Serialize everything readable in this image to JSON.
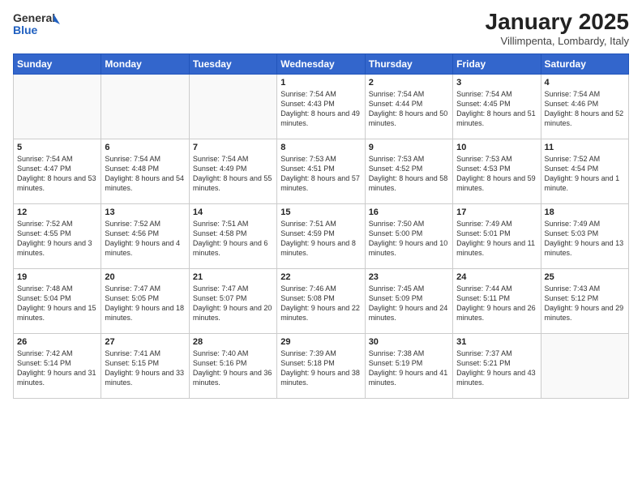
{
  "header": {
    "logo_general": "General",
    "logo_blue": "Blue",
    "month_title": "January 2025",
    "subtitle": "Villimpenta, Lombardy, Italy"
  },
  "weekdays": [
    "Sunday",
    "Monday",
    "Tuesday",
    "Wednesday",
    "Thursday",
    "Friday",
    "Saturday"
  ],
  "weeks": [
    [
      {
        "day": "",
        "info": ""
      },
      {
        "day": "",
        "info": ""
      },
      {
        "day": "",
        "info": ""
      },
      {
        "day": "1",
        "info": "Sunrise: 7:54 AM\nSunset: 4:43 PM\nDaylight: 8 hours\nand 49 minutes."
      },
      {
        "day": "2",
        "info": "Sunrise: 7:54 AM\nSunset: 4:44 PM\nDaylight: 8 hours\nand 50 minutes."
      },
      {
        "day": "3",
        "info": "Sunrise: 7:54 AM\nSunset: 4:45 PM\nDaylight: 8 hours\nand 51 minutes."
      },
      {
        "day": "4",
        "info": "Sunrise: 7:54 AM\nSunset: 4:46 PM\nDaylight: 8 hours\nand 52 minutes."
      }
    ],
    [
      {
        "day": "5",
        "info": "Sunrise: 7:54 AM\nSunset: 4:47 PM\nDaylight: 8 hours\nand 53 minutes."
      },
      {
        "day": "6",
        "info": "Sunrise: 7:54 AM\nSunset: 4:48 PM\nDaylight: 8 hours\nand 54 minutes."
      },
      {
        "day": "7",
        "info": "Sunrise: 7:54 AM\nSunset: 4:49 PM\nDaylight: 8 hours\nand 55 minutes."
      },
      {
        "day": "8",
        "info": "Sunrise: 7:53 AM\nSunset: 4:51 PM\nDaylight: 8 hours\nand 57 minutes."
      },
      {
        "day": "9",
        "info": "Sunrise: 7:53 AM\nSunset: 4:52 PM\nDaylight: 8 hours\nand 58 minutes."
      },
      {
        "day": "10",
        "info": "Sunrise: 7:53 AM\nSunset: 4:53 PM\nDaylight: 8 hours\nand 59 minutes."
      },
      {
        "day": "11",
        "info": "Sunrise: 7:52 AM\nSunset: 4:54 PM\nDaylight: 9 hours\nand 1 minute."
      }
    ],
    [
      {
        "day": "12",
        "info": "Sunrise: 7:52 AM\nSunset: 4:55 PM\nDaylight: 9 hours\nand 3 minutes."
      },
      {
        "day": "13",
        "info": "Sunrise: 7:52 AM\nSunset: 4:56 PM\nDaylight: 9 hours\nand 4 minutes."
      },
      {
        "day": "14",
        "info": "Sunrise: 7:51 AM\nSunset: 4:58 PM\nDaylight: 9 hours\nand 6 minutes."
      },
      {
        "day": "15",
        "info": "Sunrise: 7:51 AM\nSunset: 4:59 PM\nDaylight: 9 hours\nand 8 minutes."
      },
      {
        "day": "16",
        "info": "Sunrise: 7:50 AM\nSunset: 5:00 PM\nDaylight: 9 hours\nand 10 minutes."
      },
      {
        "day": "17",
        "info": "Sunrise: 7:49 AM\nSunset: 5:01 PM\nDaylight: 9 hours\nand 11 minutes."
      },
      {
        "day": "18",
        "info": "Sunrise: 7:49 AM\nSunset: 5:03 PM\nDaylight: 9 hours\nand 13 minutes."
      }
    ],
    [
      {
        "day": "19",
        "info": "Sunrise: 7:48 AM\nSunset: 5:04 PM\nDaylight: 9 hours\nand 15 minutes."
      },
      {
        "day": "20",
        "info": "Sunrise: 7:47 AM\nSunset: 5:05 PM\nDaylight: 9 hours\nand 18 minutes."
      },
      {
        "day": "21",
        "info": "Sunrise: 7:47 AM\nSunset: 5:07 PM\nDaylight: 9 hours\nand 20 minutes."
      },
      {
        "day": "22",
        "info": "Sunrise: 7:46 AM\nSunset: 5:08 PM\nDaylight: 9 hours\nand 22 minutes."
      },
      {
        "day": "23",
        "info": "Sunrise: 7:45 AM\nSunset: 5:09 PM\nDaylight: 9 hours\nand 24 minutes."
      },
      {
        "day": "24",
        "info": "Sunrise: 7:44 AM\nSunset: 5:11 PM\nDaylight: 9 hours\nand 26 minutes."
      },
      {
        "day": "25",
        "info": "Sunrise: 7:43 AM\nSunset: 5:12 PM\nDaylight: 9 hours\nand 29 minutes."
      }
    ],
    [
      {
        "day": "26",
        "info": "Sunrise: 7:42 AM\nSunset: 5:14 PM\nDaylight: 9 hours\nand 31 minutes."
      },
      {
        "day": "27",
        "info": "Sunrise: 7:41 AM\nSunset: 5:15 PM\nDaylight: 9 hours\nand 33 minutes."
      },
      {
        "day": "28",
        "info": "Sunrise: 7:40 AM\nSunset: 5:16 PM\nDaylight: 9 hours\nand 36 minutes."
      },
      {
        "day": "29",
        "info": "Sunrise: 7:39 AM\nSunset: 5:18 PM\nDaylight: 9 hours\nand 38 minutes."
      },
      {
        "day": "30",
        "info": "Sunrise: 7:38 AM\nSunset: 5:19 PM\nDaylight: 9 hours\nand 41 minutes."
      },
      {
        "day": "31",
        "info": "Sunrise: 7:37 AM\nSunset: 5:21 PM\nDaylight: 9 hours\nand 43 minutes."
      },
      {
        "day": "",
        "info": ""
      }
    ]
  ]
}
